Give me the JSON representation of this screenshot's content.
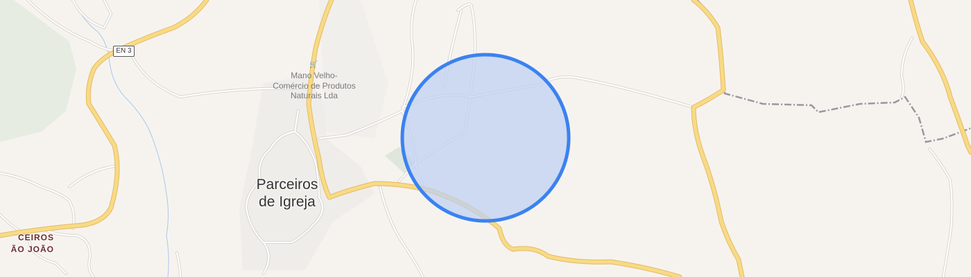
{
  "map": {
    "road_ref": "EN 3",
    "poi": {
      "icon": "shopping-basket-icon",
      "name_line1": "Mano Velho-",
      "name_line2": "Comércio de Produtos",
      "name_line3": "Naturais Lda"
    },
    "town": {
      "line1": "Parceiros",
      "line2": "de Igreja"
    },
    "hamlet": {
      "line1": "CEIROS",
      "line2": "ÃO JOÃO"
    },
    "location_marker": {
      "fill": "#cfdcf3",
      "stroke": "#3b82f0"
    },
    "colors": {
      "background": "#f6f3ef",
      "main_road": "#f7d77e",
      "main_road_casing": "#e2b65a",
      "minor_road": "#ffffff",
      "minor_road_casing": "#d8d4cf",
      "boundary": "#9a97a0",
      "river": "#9ec3e8",
      "forest": "#e4ebdf"
    }
  }
}
